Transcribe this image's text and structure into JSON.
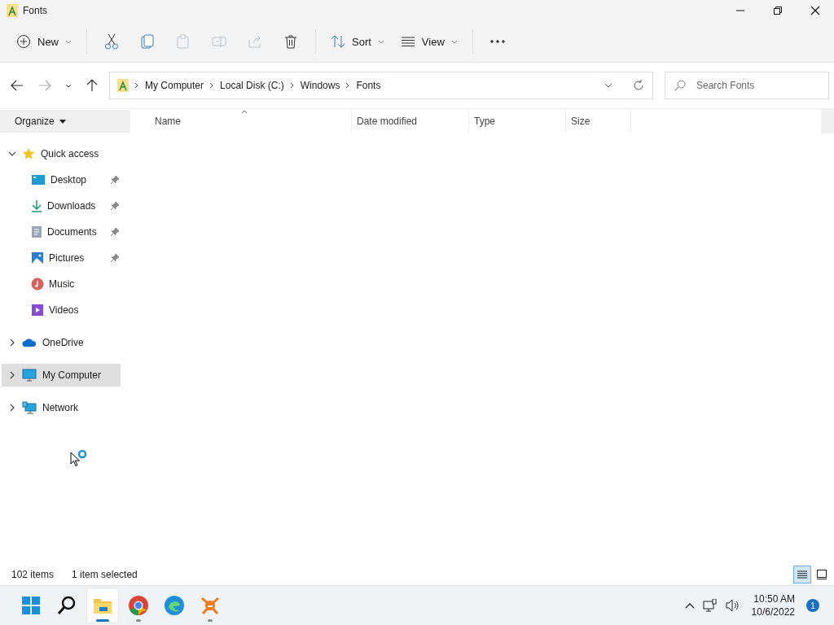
{
  "window": {
    "title": "Fonts"
  },
  "toolbar": [
    {
      "kind": "new",
      "label": "New",
      "disabled": false
    },
    {
      "kind": "cut",
      "disabled": false
    },
    {
      "kind": "copy",
      "disabled": false
    },
    {
      "kind": "paste",
      "disabled": true
    },
    {
      "kind": "rename",
      "disabled": true
    },
    {
      "kind": "share",
      "disabled": true
    },
    {
      "kind": "delete",
      "disabled": false
    },
    {
      "kind": "sort",
      "label": "Sort",
      "disabled": false
    },
    {
      "kind": "view",
      "label": "View",
      "disabled": false
    },
    {
      "kind": "more",
      "disabled": false
    }
  ],
  "navigation": {
    "back_disabled": false,
    "forward_disabled": true
  },
  "address": {
    "path": [
      "My Computer",
      "Local Disk (C:)",
      "Windows",
      "Fonts"
    ],
    "search_placeholder": "Search Fonts"
  },
  "organize": "Organize",
  "columns": [
    {
      "label": "Name",
      "sorted": true
    },
    {
      "label": "Date modified",
      "sorted": false
    },
    {
      "label": "Type",
      "sorted": false
    },
    {
      "label": "Size",
      "sorted": false
    }
  ],
  "sidebar": [
    {
      "label": "Quick access",
      "kind": "favorites",
      "expanded": true,
      "selected": false,
      "children": [
        {
          "label": "Desktop",
          "kind": "desktop",
          "pinned": true,
          "selected": false
        },
        {
          "label": "Downloads",
          "kind": "downloads",
          "pinned": true,
          "selected": false
        },
        {
          "label": "Documents",
          "kind": "documents",
          "pinned": true,
          "selected": false
        },
        {
          "label": "Pictures",
          "kind": "pictures",
          "pinned": true,
          "selected": false
        },
        {
          "label": "Music",
          "kind": "music",
          "pinned": false,
          "selected": false
        },
        {
          "label": "Videos",
          "kind": "videos",
          "pinned": false,
          "selected": false
        }
      ]
    },
    {
      "label": "OneDrive",
      "kind": "cloud",
      "expanded": false,
      "selected": false
    },
    {
      "label": "My Computer",
      "kind": "computer",
      "expanded": false,
      "selected": true
    },
    {
      "label": "Network",
      "kind": "network",
      "expanded": false,
      "selected": false
    }
  ],
  "status_bar": {
    "item_count": "102 items",
    "selection": "1 item selected",
    "views": [
      {
        "kind": "details",
        "selected": true
      },
      {
        "kind": "tiles",
        "selected": false
      }
    ]
  },
  "taskbar": {
    "apps": [
      {
        "kind": "start",
        "active": false,
        "running": false
      },
      {
        "kind": "search",
        "active": false,
        "running": false
      },
      {
        "kind": "folder",
        "active": true,
        "running": true
      },
      {
        "kind": "chrome",
        "active": false,
        "running": true
      },
      {
        "kind": "edge",
        "active": false,
        "running": false
      },
      {
        "kind": "avast",
        "active": false,
        "running": true
      }
    ],
    "time": "10:50 AM",
    "date": "10/6/2022",
    "notifications": "1"
  }
}
